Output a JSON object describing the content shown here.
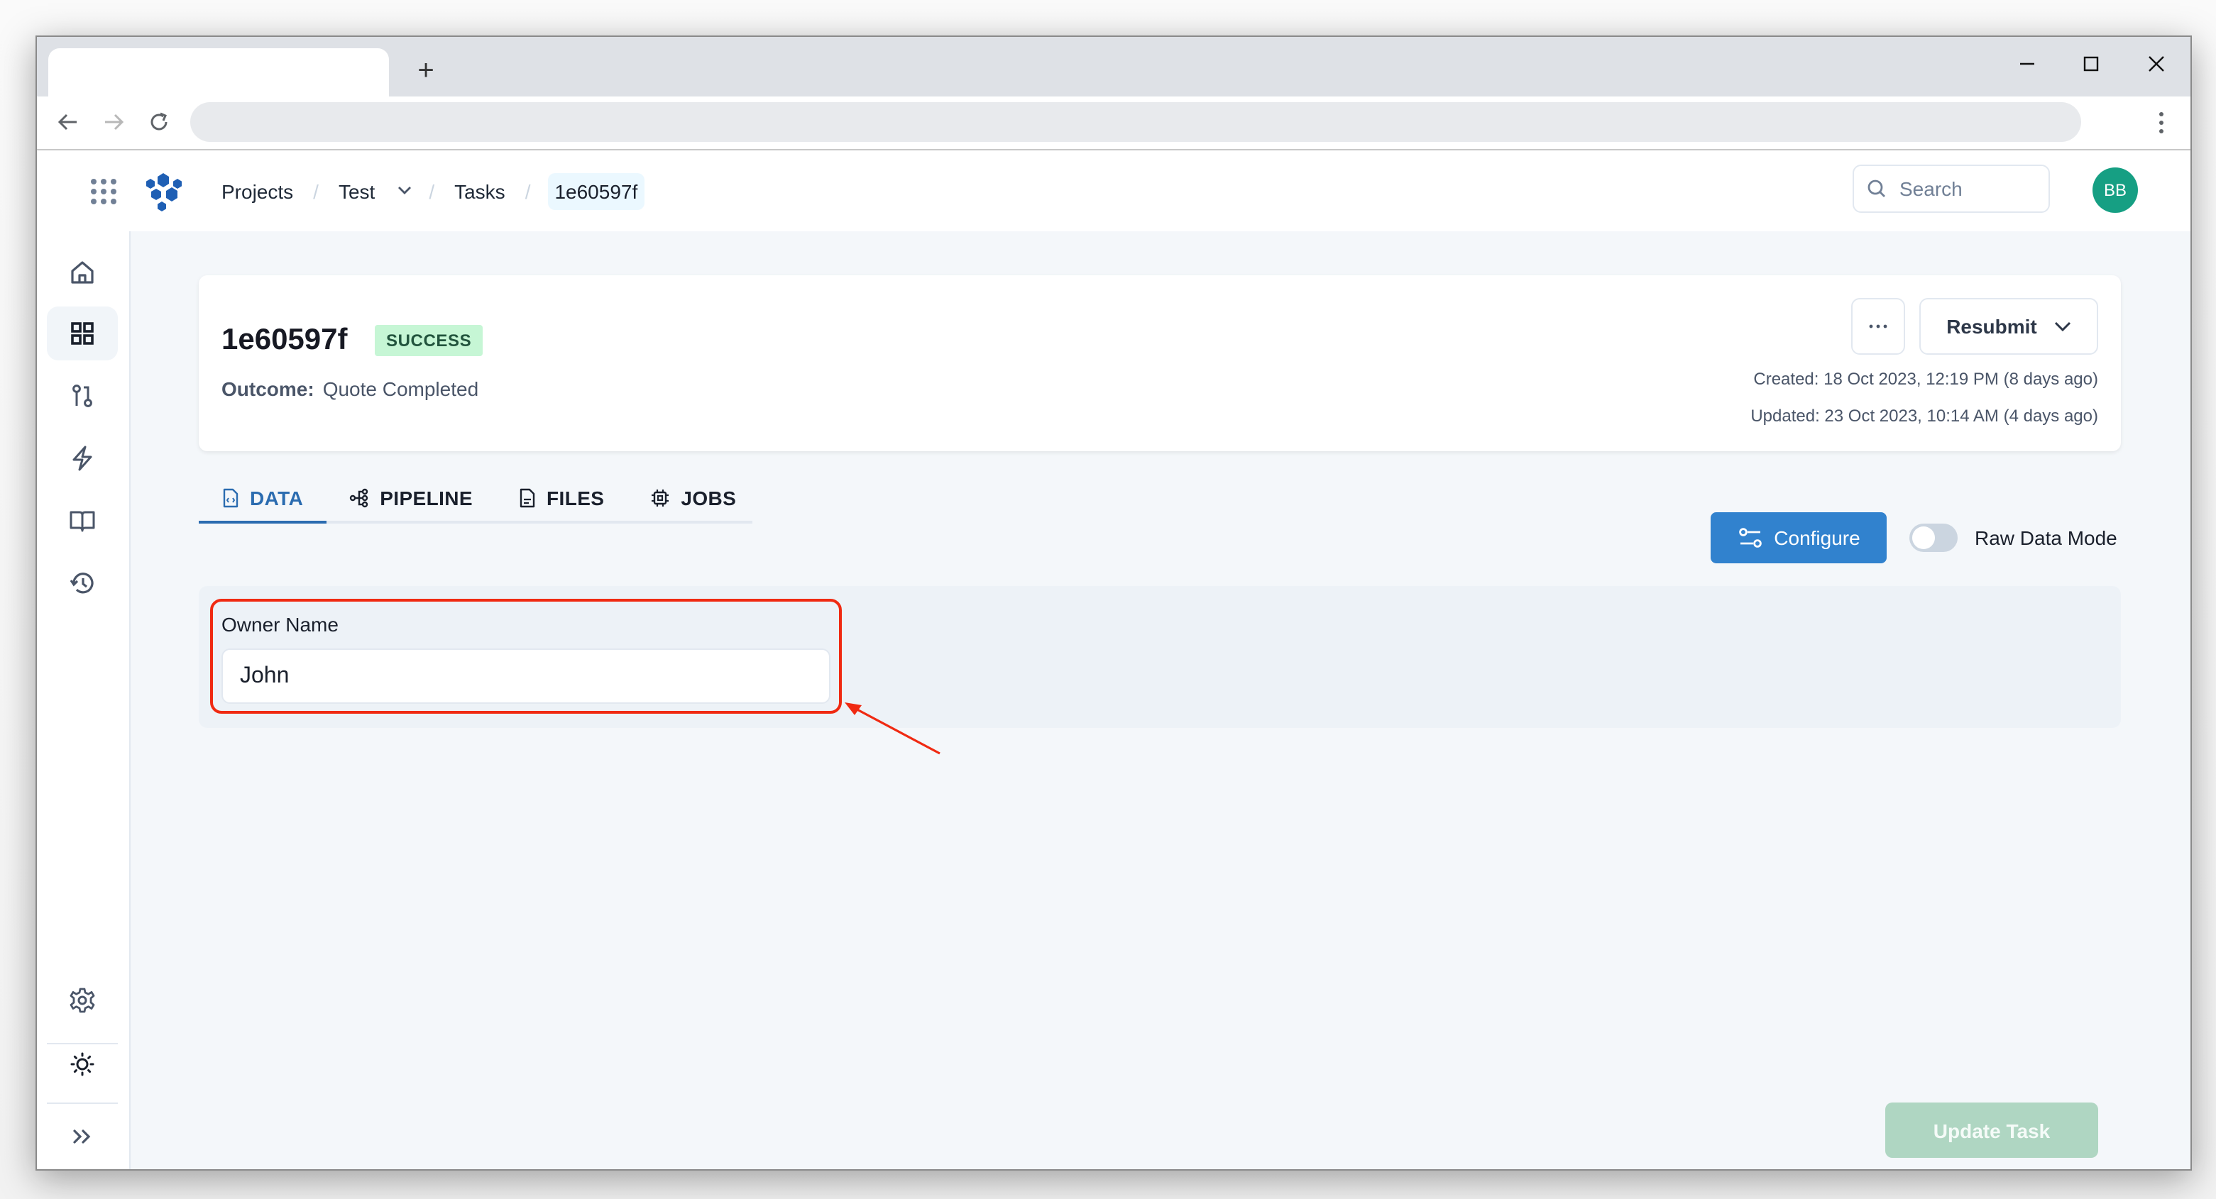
{
  "browser": {
    "tab_title": "",
    "new_tab_label": "+",
    "address": "",
    "controls": [
      "minimize",
      "maximize",
      "close"
    ]
  },
  "header": {
    "breadcrumbs": [
      {
        "label": "Projects"
      },
      {
        "label": "Test",
        "has_dropdown": true
      },
      {
        "label": "Tasks"
      },
      {
        "label": "1e60597f",
        "current": true
      }
    ],
    "separator": "/",
    "search_placeholder": "Search",
    "avatar_initials": "BB",
    "avatar_color": "#169f83"
  },
  "sidebar": {
    "items": [
      {
        "name": "home",
        "icon": "home-icon",
        "active": false
      },
      {
        "name": "dashboard",
        "icon": "grid-icon",
        "active": true
      },
      {
        "name": "pipelines",
        "icon": "git-branch-icon",
        "active": false
      },
      {
        "name": "triggers",
        "icon": "lightning-icon",
        "active": false
      },
      {
        "name": "docs",
        "icon": "book-icon",
        "active": false
      },
      {
        "name": "history",
        "icon": "history-icon",
        "active": false
      }
    ],
    "bottom_items": [
      {
        "name": "settings",
        "icon": "gear-icon"
      },
      {
        "name": "theme",
        "icon": "sun-icon"
      },
      {
        "name": "expand",
        "icon": "double-chevron-right-icon"
      }
    ]
  },
  "task": {
    "id": "1e60597f",
    "status": "SUCCESS",
    "status_bg": "#c6f6d5",
    "status_fg": "#22543d",
    "outcome_label": "Outcome:",
    "outcome_value": "Quote Completed",
    "more_label": "···",
    "resubmit_label": "Resubmit",
    "created": "Created: 18 Oct 2023, 12:19 PM (8 days ago)",
    "updated": "Updated: 23 Oct 2023, 10:14 AM (4 days ago)"
  },
  "tabs": [
    {
      "label": "DATA",
      "icon": "file-code-icon",
      "active": true
    },
    {
      "label": "PIPELINE",
      "icon": "pipeline-icon",
      "active": false
    },
    {
      "label": "FILES",
      "icon": "file-icon",
      "active": false
    },
    {
      "label": "JOBS",
      "icon": "chip-icon",
      "active": false
    }
  ],
  "toolbar": {
    "configure_label": "Configure",
    "raw_mode_label": "Raw Data Mode",
    "raw_mode_on": false,
    "accent": "#3182ce"
  },
  "form": {
    "fields": [
      {
        "label": "Owner Name",
        "value": "John",
        "placeholder": ""
      }
    ]
  },
  "footer": {
    "update_label": "Update Task",
    "update_enabled": false
  },
  "annotation": {
    "color": "#f02a12",
    "target": "Owner Name field"
  }
}
